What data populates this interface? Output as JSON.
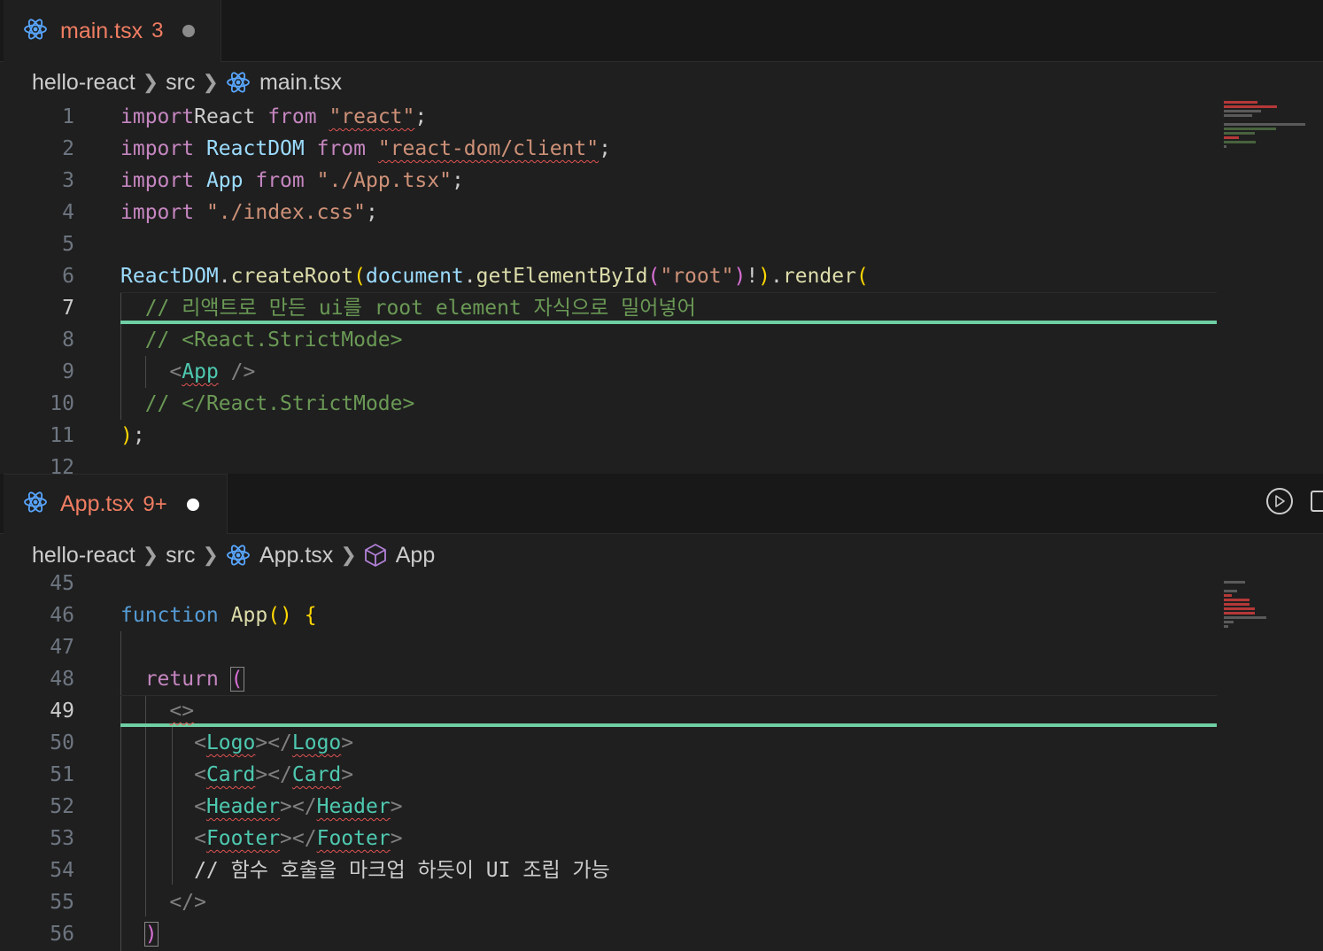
{
  "editor_top": {
    "tab": {
      "name": "main.tsx",
      "problem_count": "3"
    },
    "breadcrumb": {
      "folder": "hello-react",
      "subfolder": "src",
      "file": "main.tsx"
    },
    "active_line": "7",
    "line_numbers": [
      "1",
      "2",
      "3",
      "4",
      "5",
      "6",
      "7",
      "8",
      "9",
      "10",
      "11",
      "12"
    ]
  },
  "editor_bottom": {
    "tab": {
      "name": "App.tsx",
      "problem_count": "9+"
    },
    "breadcrumb": {
      "folder": "hello-react",
      "subfolder": "src",
      "file": "App.tsx",
      "symbol": "App"
    },
    "active_line": "49",
    "line_numbers": [
      "45",
      "46",
      "47",
      "48",
      "49",
      "50",
      "51",
      "52",
      "53",
      "54",
      "55",
      "56"
    ]
  },
  "code_top": [
    [
      [
        "k",
        "import"
      ],
      [
        "",
        "React "
      ],
      [
        "k",
        "from"
      ],
      [
        "",
        " "
      ],
      [
        "s sq",
        "\"react\""
      ],
      [
        "",
        ";"
      ]
    ],
    [
      [
        "k",
        "import"
      ],
      [
        "",
        " "
      ],
      [
        "v",
        "ReactDOM"
      ],
      [
        "",
        " "
      ],
      [
        "k",
        "from"
      ],
      [
        "",
        " "
      ],
      [
        "s sq",
        "\"react-dom/client\""
      ],
      [
        "",
        ";"
      ]
    ],
    [
      [
        "k",
        "import"
      ],
      [
        "",
        " "
      ],
      [
        "v",
        "App"
      ],
      [
        "",
        " "
      ],
      [
        "k",
        "from"
      ],
      [
        "",
        " "
      ],
      [
        "s",
        "\"./App.tsx\""
      ],
      [
        "",
        ";"
      ]
    ],
    [
      [
        "k",
        "import"
      ],
      [
        "",
        " "
      ],
      [
        "s",
        "\"./index.css\""
      ],
      [
        "",
        ";"
      ]
    ],
    [],
    [
      [
        "v",
        "ReactDOM"
      ],
      [
        "",
        "."
      ],
      [
        "f",
        "createRoot"
      ],
      [
        "br1",
        "("
      ],
      [
        "v",
        "document"
      ],
      [
        "",
        "."
      ],
      [
        "f",
        "getElementById"
      ],
      [
        "br2",
        "("
      ],
      [
        "s",
        "\"root\""
      ],
      [
        "br2",
        ")"
      ],
      [
        "",
        "!"
      ],
      [
        "br1",
        ")"
      ],
      [
        "",
        "."
      ],
      [
        "f",
        "render"
      ],
      [
        "br1",
        "("
      ]
    ],
    [
      [
        "",
        "  "
      ],
      [
        "c",
        "// 리액트로 만든 ui를 root element 자식으로 밀어넣어"
      ]
    ],
    [
      [
        "",
        "  "
      ],
      [
        "c",
        "// <React.StrictMode>"
      ]
    ],
    [
      [
        "",
        "    "
      ],
      [
        "g",
        "<"
      ],
      [
        "t sq",
        "App"
      ],
      [
        "",
        " "
      ],
      [
        "g",
        "/>"
      ]
    ],
    [
      [
        "",
        "  "
      ],
      [
        "c",
        "// </React.StrictMode>"
      ]
    ],
    [
      [
        "br1",
        ")"
      ],
      [
        "",
        ";"
      ]
    ],
    []
  ],
  "code_bottom": [
    [],
    [
      [
        "b",
        "function"
      ],
      [
        "",
        " "
      ],
      [
        "f",
        "App"
      ],
      [
        "br1",
        "()"
      ],
      [
        "",
        " "
      ],
      [
        "br1",
        "{"
      ]
    ],
    [],
    [
      [
        "",
        "  "
      ],
      [
        "k",
        "return"
      ],
      [
        "",
        " "
      ],
      [
        "br2 bx",
        "("
      ]
    ],
    [
      [
        "",
        "    "
      ],
      [
        "g sq",
        "<>"
      ]
    ],
    [
      [
        "",
        "      "
      ],
      [
        "g",
        "<"
      ],
      [
        "t sq",
        "Logo"
      ],
      [
        "g",
        "></"
      ],
      [
        "t sq",
        "Logo"
      ],
      [
        "g",
        ">"
      ]
    ],
    [
      [
        "",
        "      "
      ],
      [
        "g",
        "<"
      ],
      [
        "t sq",
        "Card"
      ],
      [
        "g",
        "></"
      ],
      [
        "t sq",
        "Card"
      ],
      [
        "g",
        ">"
      ]
    ],
    [
      [
        "",
        "      "
      ],
      [
        "g",
        "<"
      ],
      [
        "t sq",
        "Header"
      ],
      [
        "g",
        "></"
      ],
      [
        "t sq",
        "Header"
      ],
      [
        "g",
        ">"
      ]
    ],
    [
      [
        "",
        "      "
      ],
      [
        "g",
        "<"
      ],
      [
        "t sq",
        "Footer"
      ],
      [
        "g",
        "></"
      ],
      [
        "t sq",
        "Footer"
      ],
      [
        "g",
        ">"
      ]
    ],
    [
      [
        "",
        "      // 함수 호출을 마크업 하듯이 UI 조립 가능"
      ]
    ],
    [
      [
        "",
        "    "
      ],
      [
        "g",
        "</>"
      ]
    ],
    [
      [
        "",
        "  "
      ],
      [
        "br2 bx",
        ")"
      ]
    ]
  ]
}
